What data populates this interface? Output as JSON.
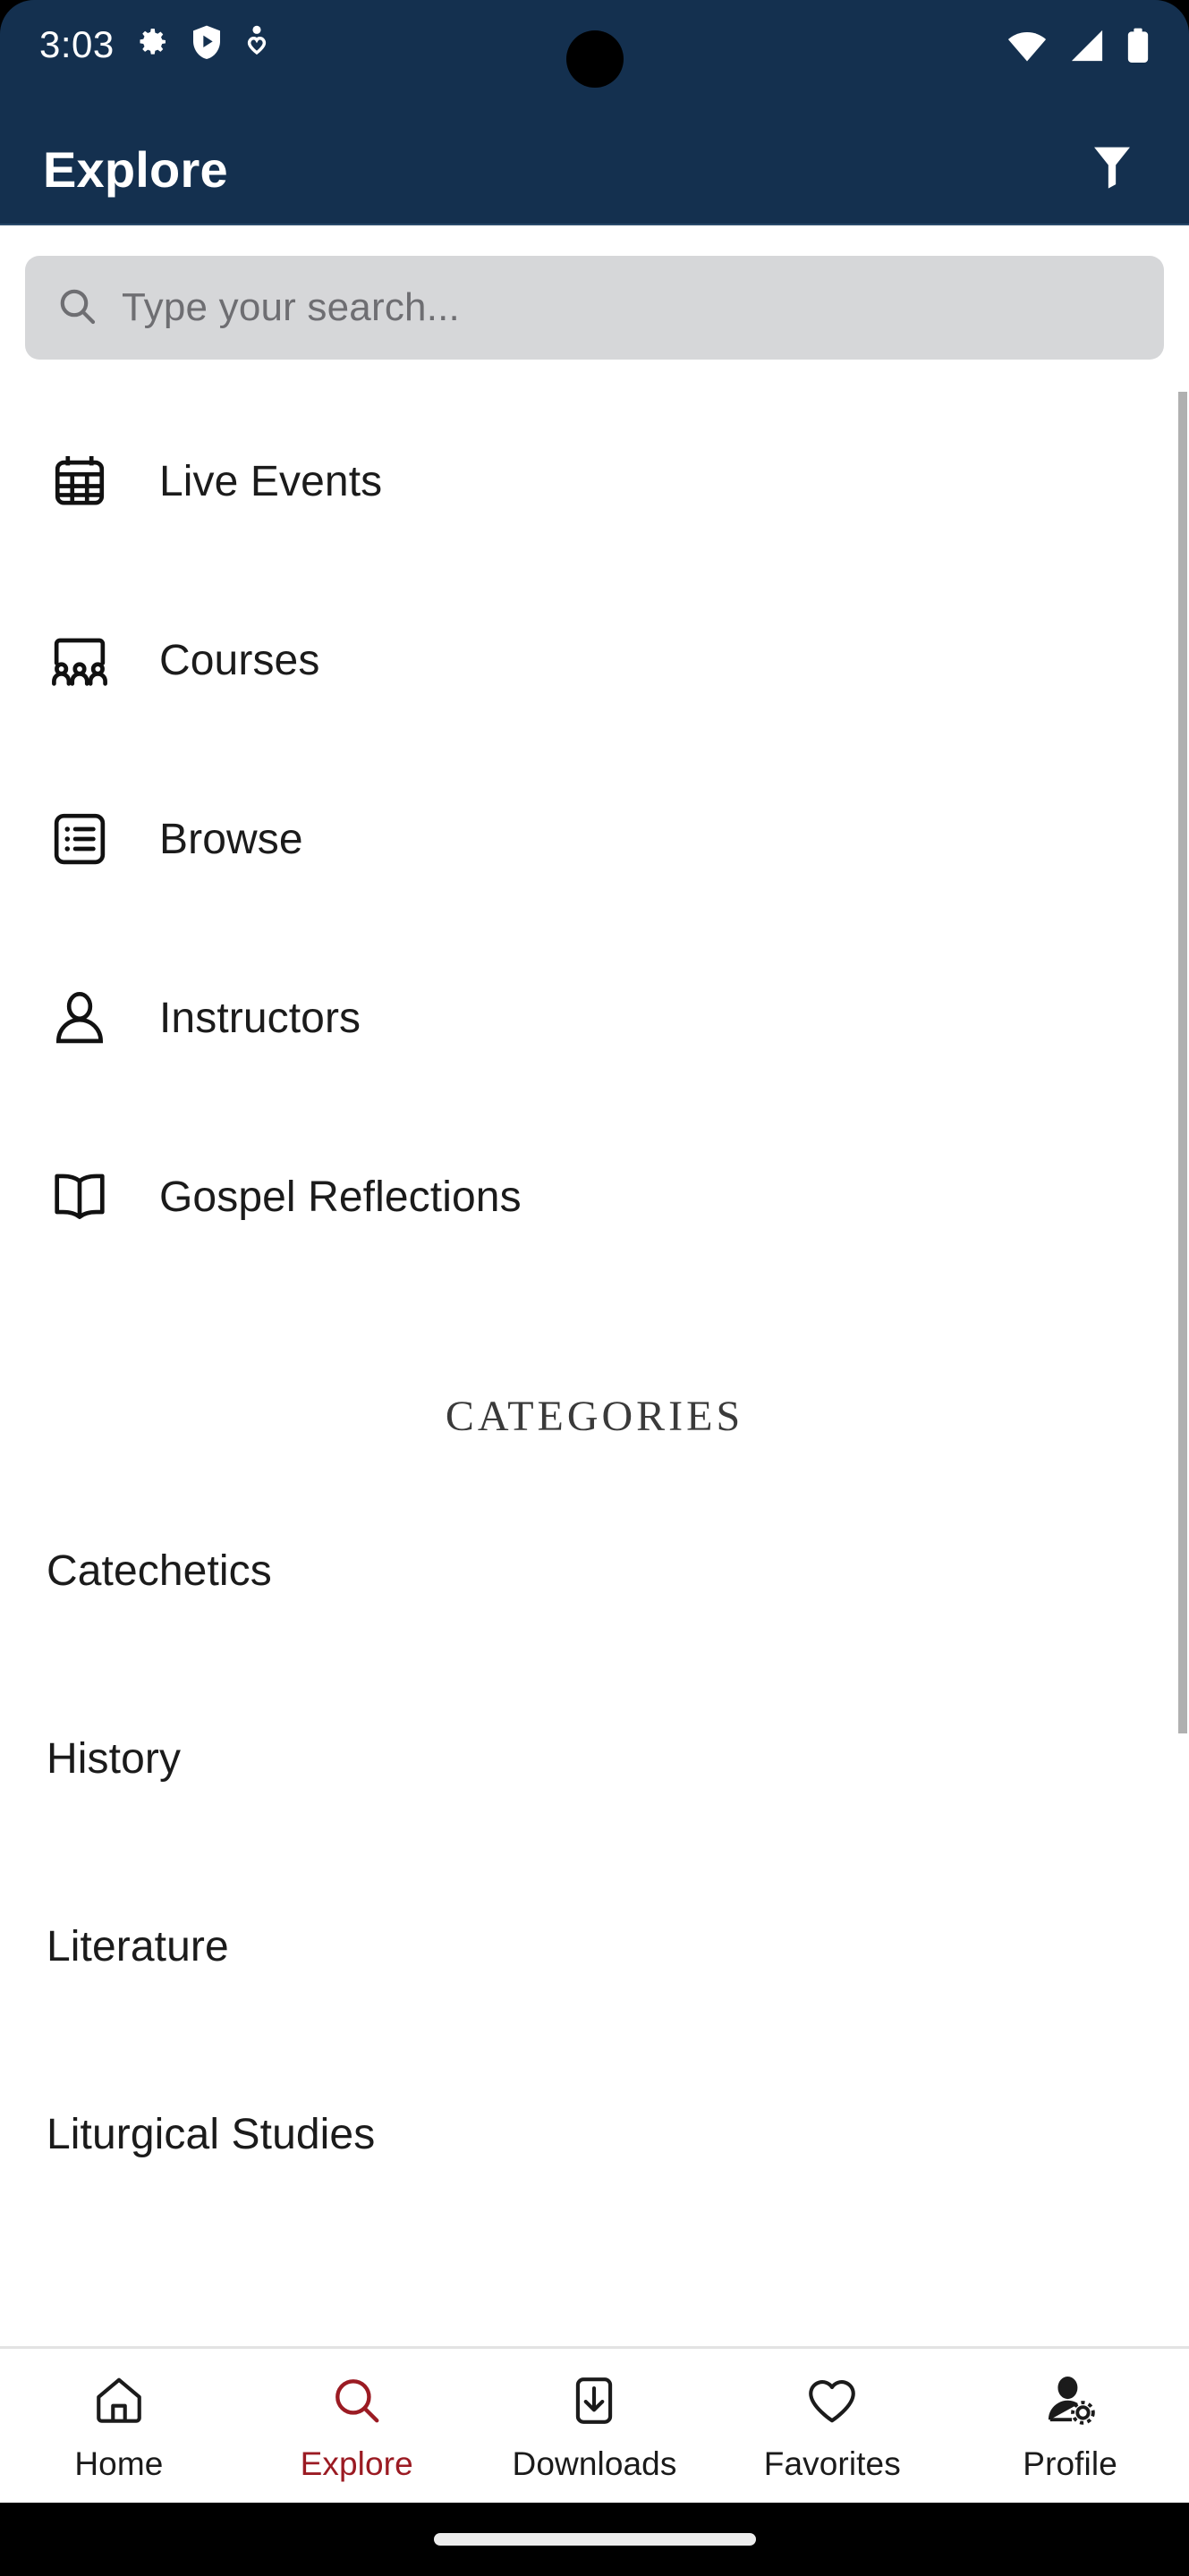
{
  "status_bar": {
    "time": "3:03",
    "left_icons": [
      "gear-icon",
      "shield-play-icon",
      "location-heart-icon"
    ],
    "right_icons": [
      "wifi-icon",
      "cellular-signal-icon",
      "battery-icon"
    ],
    "background_color": "#14304F"
  },
  "app_bar": {
    "title": "Explore",
    "filter_icon": "filter-funnel-icon",
    "background_color": "#14304F",
    "title_color": "#ffffff"
  },
  "search": {
    "placeholder": "Type your search...",
    "value": "",
    "icon": "search-icon",
    "background_color": "#d6d7d9",
    "text_color": "#6e6e72"
  },
  "nav_items": [
    {
      "label": "Live Events",
      "icon": "calendar-icon"
    },
    {
      "label": "Courses",
      "icon": "group-people-icon"
    },
    {
      "label": "Browse",
      "icon": "list-box-icon"
    },
    {
      "label": "Instructors",
      "icon": "person-icon"
    },
    {
      "label": "Gospel Reflections",
      "icon": "open-book-icon"
    }
  ],
  "categories_section": {
    "heading": "CATEGORIES",
    "items": [
      {
        "label": "Catechetics"
      },
      {
        "label": "History"
      },
      {
        "label": "Literature"
      },
      {
        "label": "Liturgical Studies"
      }
    ]
  },
  "bottom_nav": {
    "active_index": 1,
    "active_color": "#9B1B23",
    "inactive_color": "#1b1b1b",
    "items": [
      {
        "label": "Home",
        "icon": "home-icon"
      },
      {
        "label": "Explore",
        "icon": "search-icon"
      },
      {
        "label": "Downloads",
        "icon": "download-box-icon"
      },
      {
        "label": "Favorites",
        "icon": "heart-icon"
      },
      {
        "label": "Profile",
        "icon": "person-gear-icon"
      }
    ]
  },
  "scrollbar": {
    "visible": true,
    "thumb_color": "#b0b0b0"
  }
}
